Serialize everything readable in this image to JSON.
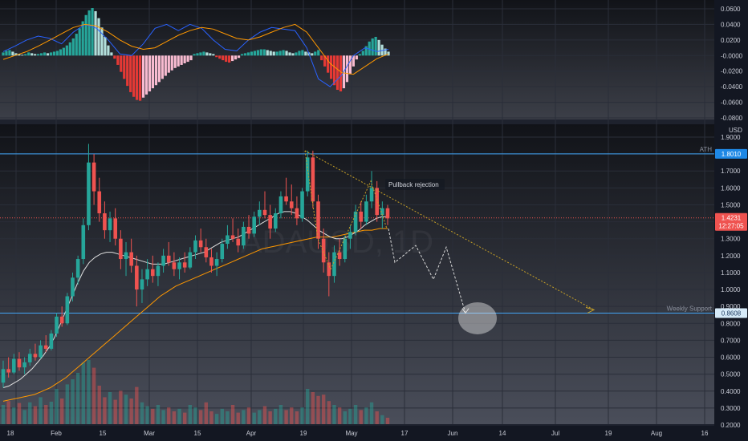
{
  "chart_data": [
    {
      "type": "bar",
      "panel": "oscillator",
      "ylim": [
        -0.08,
        0.07
      ],
      "y_ticks": [
        "0.0600",
        "0.0400",
        "0.0200",
        "-0.0000",
        "-0.0200",
        "-0.0400",
        "-0.0600",
        "-0.0800"
      ],
      "colors": {
        "pos_strong": "#26a69a",
        "pos_weak": "#b2dfdb",
        "neg_strong": "#e53935",
        "neg_weak": "#f8bbd0",
        "line_fast": "#2962ff",
        "line_slow": "#ff9800"
      },
      "histogram": [
        0.004,
        0.006,
        0.007,
        0.005,
        0.003,
        0.002,
        0.001,
        0.002,
        0.004,
        0.003,
        0.002,
        0.002,
        0.003,
        0.004,
        0.003,
        0.004,
        0.005,
        0.006,
        0.008,
        0.01,
        0.013,
        0.017,
        0.022,
        0.028,
        0.035,
        0.044,
        0.052,
        0.058,
        0.061,
        0.057,
        0.048,
        0.036,
        0.024,
        0.013,
        0.004,
        -0.004,
        -0.012,
        -0.021,
        -0.03,
        -0.039,
        -0.047,
        -0.053,
        -0.057,
        -0.058,
        -0.054,
        -0.05,
        -0.046,
        -0.042,
        -0.038,
        -0.034,
        -0.03,
        -0.026,
        -0.022,
        -0.019,
        -0.016,
        -0.014,
        -0.012,
        -0.01,
        -0.008,
        -0.006,
        0.002,
        0.003,
        0.004,
        0.005,
        0.004,
        0.003,
        0.002,
        -0.002,
        -0.004,
        -0.006,
        -0.008,
        -0.009,
        -0.007,
        -0.005,
        -0.003,
        0.002,
        0.003,
        0.004,
        0.005,
        0.006,
        0.007,
        0.008,
        0.008,
        0.007,
        0.006,
        0.005,
        0.005,
        0.006,
        0.007,
        0.006,
        0.004,
        0.003,
        0.004,
        0.006,
        0.007,
        0.005,
        0.004,
        0.003,
        0.005,
        0.007,
        -0.006,
        -0.014,
        -0.022,
        -0.03,
        -0.038,
        -0.044,
        -0.046,
        -0.042,
        -0.034,
        -0.024,
        -0.014,
        -0.005,
        0.002,
        0.006,
        0.012,
        0.018,
        0.022,
        0.024,
        0.02,
        0.014,
        0.009,
        0.005
      ],
      "line_fast": [
        0.035,
        0.042,
        0.05,
        0.055,
        0.052,
        0.045,
        0.06,
        0.07,
        0.065,
        0.05,
        0.032,
        0.03,
        0.045,
        0.065,
        0.07,
        0.062,
        0.07,
        0.065,
        0.05,
        0.038,
        0.036,
        0.05,
        0.06,
        0.066,
        0.064,
        0.062,
        0.04,
        0.0,
        -0.01,
        0.005,
        0.03,
        0.04,
        0.035,
        0.038
      ],
      "line_slow": [
        0.025,
        0.03,
        0.035,
        0.042,
        0.05,
        0.058,
        0.066,
        0.07,
        0.068,
        0.06,
        0.05,
        0.042,
        0.038,
        0.04,
        0.048,
        0.056,
        0.062,
        0.066,
        0.064,
        0.058,
        0.052,
        0.05,
        0.054,
        0.06,
        0.066,
        0.07,
        0.06,
        0.04,
        0.02,
        0.008,
        0.006,
        0.016,
        0.026,
        0.032
      ]
    },
    {
      "type": "candlestick",
      "panel": "price",
      "ylim": [
        0.2,
        1.9
      ],
      "y_ticks": [
        "1.9000",
        "1.8000",
        "1.7000",
        "1.6000",
        "1.5000",
        "1.4000",
        "1.3000",
        "1.2000",
        "1.1000",
        "1.0000",
        "0.9000",
        "0.8000",
        "0.7000",
        "0.6000",
        "0.5000",
        "0.4000",
        "0.3000",
        "0.2000"
      ],
      "x_ticks": [
        "18",
        "Feb",
        "15",
        "Mar",
        "15",
        "Apr",
        "19",
        "May",
        "17",
        "Jun",
        "14",
        "Jul",
        "19",
        "Aug",
        "16"
      ],
      "currency": "USD",
      "watermark": "ADAUSD, 1D",
      "last_price": 1.4231,
      "last_price_label": "1.4231",
      "countdown": "12:27:05",
      "colors": {
        "up": "#26a69a",
        "down": "#ef5350",
        "ma_fast": "#e0e0e0",
        "ma_slow": "#ff9800",
        "level": "#42a5f5",
        "projection": "#c9a227"
      },
      "candles": [
        [
          0.45,
          0.58,
          0.42,
          0.53
        ],
        [
          0.53,
          0.6,
          0.48,
          0.51
        ],
        [
          0.51,
          0.62,
          0.5,
          0.59
        ],
        [
          0.59,
          0.63,
          0.52,
          0.54
        ],
        [
          0.54,
          0.6,
          0.5,
          0.57
        ],
        [
          0.57,
          0.65,
          0.55,
          0.62
        ],
        [
          0.62,
          0.68,
          0.58,
          0.6
        ],
        [
          0.6,
          0.7,
          0.59,
          0.67
        ],
        [
          0.67,
          0.73,
          0.63,
          0.65
        ],
        [
          0.65,
          0.76,
          0.64,
          0.74
        ],
        [
          0.74,
          0.86,
          0.72,
          0.84
        ],
        [
          0.84,
          0.9,
          0.78,
          0.8
        ],
        [
          0.8,
          0.98,
          0.79,
          0.96
        ],
        [
          0.96,
          1.1,
          0.93,
          1.07
        ],
        [
          1.07,
          1.2,
          1.03,
          1.18
        ],
        [
          1.18,
          1.42,
          1.15,
          1.38
        ],
        [
          1.38,
          1.86,
          1.35,
          1.75
        ],
        [
          1.75,
          1.8,
          1.5,
          1.58
        ],
        [
          1.58,
          1.66,
          1.4,
          1.45
        ],
        [
          1.45,
          1.52,
          1.3,
          1.35
        ],
        [
          1.35,
          1.46,
          1.28,
          1.42
        ],
        [
          1.42,
          1.48,
          1.26,
          1.3
        ],
        [
          1.3,
          1.35,
          1.12,
          1.18
        ],
        [
          1.18,
          1.28,
          1.08,
          1.22
        ],
        [
          1.22,
          1.3,
          1.1,
          1.14
        ],
        [
          1.14,
          1.2,
          0.9,
          1.0
        ],
        [
          1.0,
          1.12,
          0.92,
          1.06
        ],
        [
          1.06,
          1.18,
          1.02,
          1.12
        ],
        [
          1.12,
          1.2,
          1.04,
          1.08
        ],
        [
          1.08,
          1.16,
          1.02,
          1.14
        ],
        [
          1.14,
          1.24,
          1.1,
          1.2
        ],
        [
          1.2,
          1.28,
          1.14,
          1.16
        ],
        [
          1.16,
          1.22,
          1.08,
          1.12
        ],
        [
          1.12,
          1.19,
          1.06,
          1.16
        ],
        [
          1.16,
          1.22,
          1.1,
          1.13
        ],
        [
          1.13,
          1.25,
          1.12,
          1.22
        ],
        [
          1.22,
          1.32,
          1.18,
          1.29
        ],
        [
          1.29,
          1.36,
          1.22,
          1.25
        ],
        [
          1.25,
          1.3,
          1.16,
          1.19
        ],
        [
          1.19,
          1.24,
          1.1,
          1.14
        ],
        [
          1.14,
          1.22,
          1.08,
          1.18
        ],
        [
          1.18,
          1.3,
          1.16,
          1.27
        ],
        [
          1.27,
          1.38,
          1.24,
          1.32
        ],
        [
          1.32,
          1.42,
          1.28,
          1.3
        ],
        [
          1.3,
          1.36,
          1.22,
          1.26
        ],
        [
          1.26,
          1.4,
          1.24,
          1.37
        ],
        [
          1.37,
          1.44,
          1.3,
          1.33
        ],
        [
          1.33,
          1.46,
          1.31,
          1.43
        ],
        [
          1.43,
          1.52,
          1.38,
          1.47
        ],
        [
          1.47,
          1.58,
          1.42,
          1.44
        ],
        [
          1.44,
          1.5,
          1.3,
          1.36
        ],
        [
          1.36,
          1.48,
          1.34,
          1.45
        ],
        [
          1.45,
          1.58,
          1.42,
          1.55
        ],
        [
          1.55,
          1.66,
          1.5,
          1.52
        ],
        [
          1.52,
          1.62,
          1.44,
          1.48
        ],
        [
          1.48,
          1.55,
          1.38,
          1.42
        ],
        [
          1.42,
          1.6,
          1.4,
          1.58
        ],
        [
          1.58,
          1.82,
          1.55,
          1.78
        ],
        [
          1.78,
          1.82,
          1.48,
          1.52
        ],
        [
          1.52,
          1.56,
          1.24,
          1.3
        ],
        [
          1.3,
          1.36,
          1.1,
          1.16
        ],
        [
          1.16,
          1.22,
          0.96,
          1.08
        ],
        [
          1.08,
          1.26,
          1.04,
          1.22
        ],
        [
          1.22,
          1.3,
          1.14,
          1.18
        ],
        [
          1.18,
          1.32,
          1.16,
          1.3
        ],
        [
          1.3,
          1.38,
          1.24,
          1.34
        ],
        [
          1.34,
          1.5,
          1.32,
          1.46
        ],
        [
          1.46,
          1.52,
          1.36,
          1.4
        ],
        [
          1.4,
          1.56,
          1.38,
          1.52
        ],
        [
          1.52,
          1.7,
          1.48,
          1.6
        ],
        [
          1.6,
          1.64,
          1.4,
          1.44
        ],
        [
          1.44,
          1.52,
          1.36,
          1.48
        ],
        [
          1.48,
          1.5,
          1.38,
          1.42
        ]
      ],
      "ma_fast": [
        0.42,
        0.43,
        0.45,
        0.47,
        0.5,
        0.53,
        0.57,
        0.61,
        0.66,
        0.72,
        0.8,
        0.88,
        0.96,
        1.04,
        1.11,
        1.16,
        1.19,
        1.21,
        1.22,
        1.22,
        1.21,
        1.2,
        1.19,
        1.18,
        1.17,
        1.16,
        1.15,
        1.15,
        1.15,
        1.16,
        1.17,
        1.18,
        1.19,
        1.2,
        1.21,
        1.22,
        1.24,
        1.26,
        1.28,
        1.29,
        1.3,
        1.31,
        1.33,
        1.35,
        1.37,
        1.39,
        1.41,
        1.43,
        1.45,
        1.46,
        1.46,
        1.45,
        1.43,
        1.41,
        1.38,
        1.35,
        1.33,
        1.31,
        1.3,
        1.3,
        1.31,
        1.33,
        1.35,
        1.38,
        1.4,
        1.42,
        1.43,
        1.43
      ],
      "ma_slow": [
        0.34,
        0.35,
        0.36,
        0.37,
        0.38,
        0.4,
        0.42,
        0.45,
        0.48,
        0.52,
        0.56,
        0.6,
        0.64,
        0.68,
        0.72,
        0.76,
        0.8,
        0.84,
        0.88,
        0.92,
        0.96,
        0.99,
        1.02,
        1.04,
        1.06,
        1.08,
        1.1,
        1.12,
        1.14,
        1.16,
        1.18,
        1.2,
        1.22,
        1.24,
        1.25,
        1.26,
        1.27,
        1.28,
        1.29,
        1.3,
        1.31,
        1.31,
        1.31,
        1.32,
        1.33,
        1.34,
        1.35,
        1.35,
        1.36,
        1.36
      ],
      "volume": [
        0.3,
        0.36,
        0.26,
        0.33,
        0.22,
        0.34,
        0.28,
        0.42,
        0.3,
        0.35,
        0.55,
        0.4,
        0.62,
        0.7,
        0.8,
        0.96,
        1.0,
        0.88,
        0.6,
        0.42,
        0.5,
        0.38,
        0.52,
        0.46,
        0.4,
        0.58,
        0.34,
        0.28,
        0.24,
        0.3,
        0.22,
        0.26,
        0.2,
        0.24,
        0.18,
        0.3,
        0.26,
        0.22,
        0.34,
        0.2,
        0.16,
        0.24,
        0.2,
        0.3,
        0.18,
        0.22,
        0.26,
        0.18,
        0.22,
        0.28,
        0.2,
        0.24,
        0.3,
        0.22,
        0.26,
        0.2,
        0.26,
        0.55,
        0.5,
        0.44,
        0.46,
        0.36,
        0.3,
        0.26,
        0.2,
        0.24,
        0.3,
        0.22,
        0.26,
        0.34,
        0.2,
        0.14,
        0.1
      ],
      "levels": [
        {
          "label": "ATH",
          "value": 1.801,
          "badge": "1.8010"
        },
        {
          "label": "Weekly Support",
          "value": 0.8608,
          "badge": "0.8608"
        }
      ],
      "annotations": [
        {
          "text": "Pullback rejection"
        }
      ],
      "projection_path": [
        [
          1.42,
          1.16
        ],
        [
          1.2,
          1.06
        ],
        [
          1.25,
          1.0
        ],
        [
          0.86,
          0.86
        ]
      ],
      "target_zone": {
        "value": 0.83
      }
    }
  ]
}
